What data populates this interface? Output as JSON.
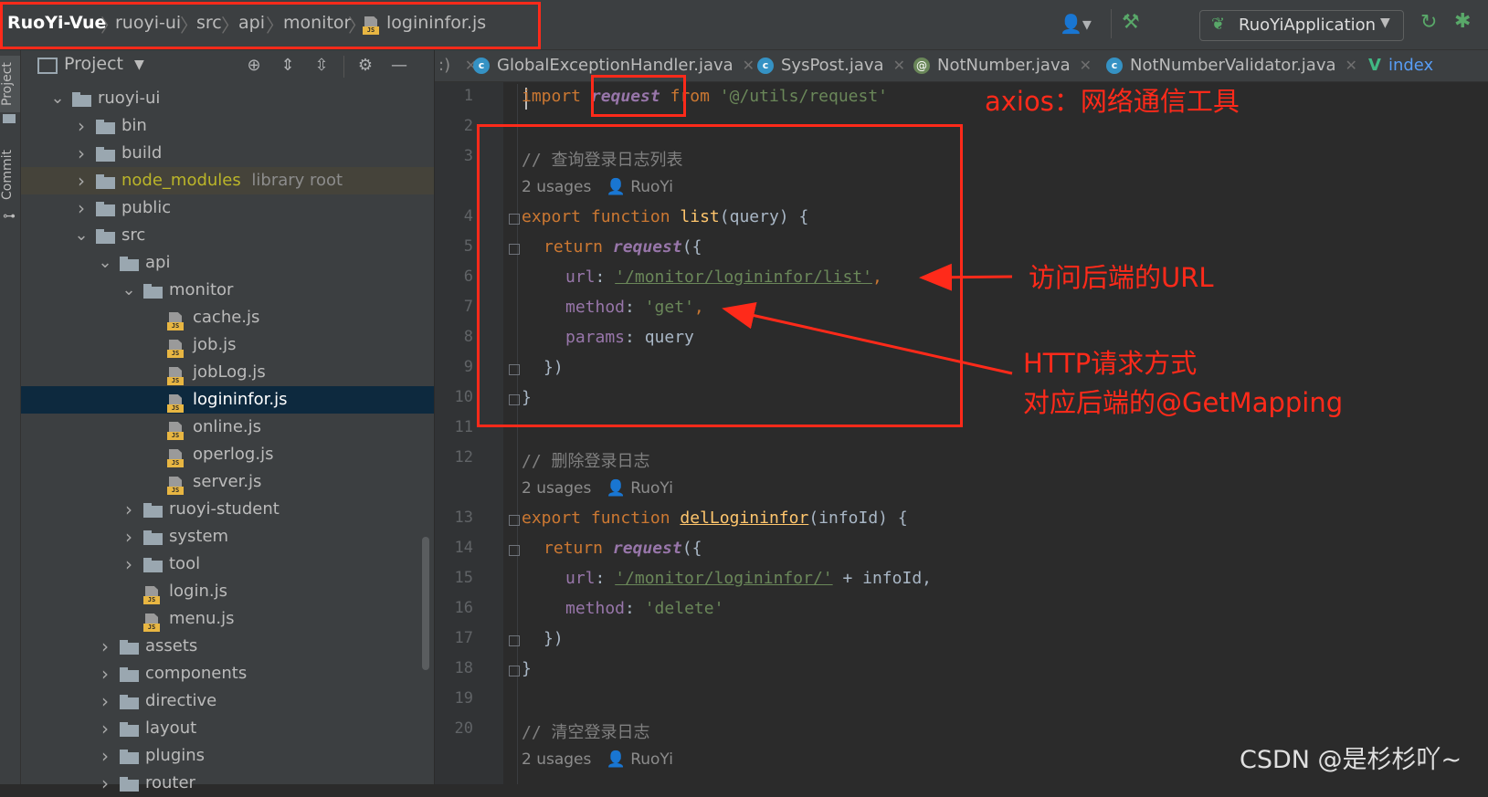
{
  "breadcrumb": {
    "items": [
      "RuoYi-Vue",
      "ruoyi-ui",
      "src",
      "api",
      "monitor",
      "logininfor.js"
    ]
  },
  "toolbar": {
    "run_config": "RuoYiApplication"
  },
  "side_tabs": {
    "project": "Project",
    "commit": "Commit"
  },
  "project_panel": {
    "title": "Project",
    "tree": [
      {
        "label": "ruoyi-ui",
        "type": "folder",
        "depth": 0,
        "expanded": true
      },
      {
        "label": "bin",
        "type": "folder",
        "depth": 1,
        "expanded": false
      },
      {
        "label": "build",
        "type": "folder",
        "depth": 1,
        "expanded": false
      },
      {
        "label": "node_modules",
        "suffix": "library root",
        "type": "folder",
        "depth": 1,
        "expanded": false,
        "libroot": true
      },
      {
        "label": "public",
        "type": "folder",
        "depth": 1,
        "expanded": false
      },
      {
        "label": "src",
        "type": "folder",
        "depth": 1,
        "expanded": true
      },
      {
        "label": "api",
        "type": "folder",
        "depth": 2,
        "expanded": true
      },
      {
        "label": "monitor",
        "type": "folder",
        "depth": 3,
        "expanded": true
      },
      {
        "label": "cache.js",
        "type": "js",
        "depth": 4
      },
      {
        "label": "job.js",
        "type": "js",
        "depth": 4
      },
      {
        "label": "jobLog.js",
        "type": "js",
        "depth": 4
      },
      {
        "label": "logininfor.js",
        "type": "js",
        "depth": 4,
        "selected": true
      },
      {
        "label": "online.js",
        "type": "js",
        "depth": 4
      },
      {
        "label": "operlog.js",
        "type": "js",
        "depth": 4
      },
      {
        "label": "server.js",
        "type": "js",
        "depth": 4
      },
      {
        "label": "ruoyi-student",
        "type": "folder",
        "depth": 3,
        "expanded": false
      },
      {
        "label": "system",
        "type": "folder",
        "depth": 3,
        "expanded": false
      },
      {
        "label": "tool",
        "type": "folder",
        "depth": 3,
        "expanded": false
      },
      {
        "label": "login.js",
        "type": "js",
        "depth": 3
      },
      {
        "label": "menu.js",
        "type": "js",
        "depth": 3
      },
      {
        "label": "assets",
        "type": "folder",
        "depth": 2,
        "expanded": false
      },
      {
        "label": "components",
        "type": "folder",
        "depth": 2,
        "expanded": false
      },
      {
        "label": "directive",
        "type": "folder",
        "depth": 2,
        "expanded": false
      },
      {
        "label": "layout",
        "type": "folder",
        "depth": 2,
        "expanded": false
      },
      {
        "label": "plugins",
        "type": "folder",
        "depth": 2,
        "expanded": false
      },
      {
        "label": "router",
        "type": "folder",
        "depth": 2,
        "expanded": false
      }
    ]
  },
  "editor_tabs": [
    {
      "label": "GlobalExceptionHandler.java",
      "icon": "class"
    },
    {
      "label": "SysPost.java",
      "icon": "class"
    },
    {
      "label": "NotNumber.java",
      "icon": "annotation"
    },
    {
      "label": "NotNumberValidator.java",
      "icon": "class"
    },
    {
      "label": "index",
      "icon": "vue"
    }
  ],
  "editor": {
    "line_numbers": [
      "1",
      "2",
      "3",
      "4",
      "5",
      "6",
      "7",
      "8",
      "9",
      "10",
      "11",
      "12",
      "13",
      "14",
      "15",
      "16",
      "17",
      "18",
      "19",
      "20"
    ],
    "usages_label": "2 usages",
    "author": "RuoYi",
    "code": {
      "l1": [
        "import",
        "request",
        "from",
        "'@/utils/request'"
      ],
      "l3": "// 查询登录日志列表",
      "l4": [
        "export",
        "function",
        "list",
        "(query) {"
      ],
      "l5": [
        "return",
        "request",
        "({"
      ],
      "l6": [
        "url",
        ": ",
        "'/monitor/logininfor/list'",
        ","
      ],
      "l7": [
        "method",
        ": ",
        "'get'",
        ","
      ],
      "l8": [
        "params",
        ": query"
      ],
      "l9": "})",
      "l10": "}",
      "l12": "// 删除登录日志",
      "l13": [
        "export",
        "function",
        "delLogininfor",
        "(infoId) {"
      ],
      "l14": [
        "return",
        "request",
        "({"
      ],
      "l15": [
        "url",
        ": ",
        "'/monitor/logininfor/'",
        " + infoId,"
      ],
      "l16": [
        "method",
        ": ",
        "'delete'"
      ],
      "l17": "})",
      "l18": "}",
      "l20": "// 清空登录日志"
    }
  },
  "annotations": {
    "axios": "axios：网络通信工具",
    "url": "访问后端的URL",
    "http1": "HTTP请求方式",
    "http2": "对应后端的@GetMapping"
  },
  "watermark": "CSDN @是杉杉吖~",
  "colors": {
    "annotation_red": "#ff2a1a",
    "keyword": "#cc7832",
    "string": "#6a8759",
    "purple": "#9876aa",
    "function_yellow": "#ffc66d",
    "comment": "#808080"
  }
}
